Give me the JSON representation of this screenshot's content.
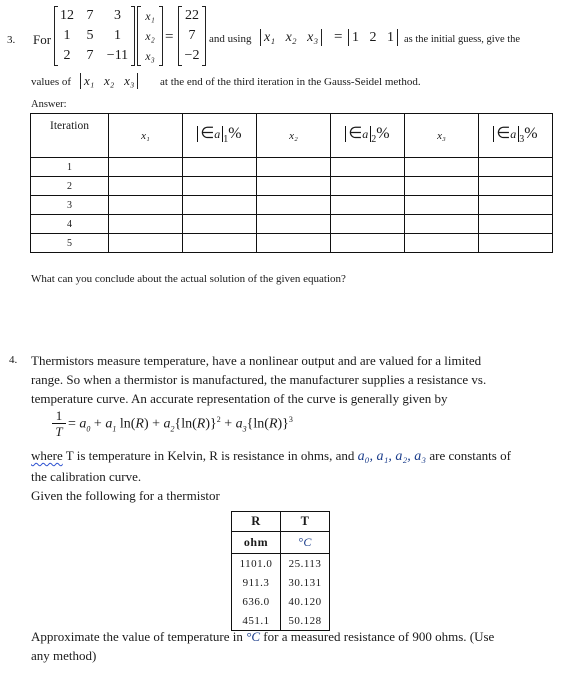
{
  "q3": {
    "number": "3.",
    "for_label": "For",
    "matrix_A": [
      [
        "12",
        "7",
        "3"
      ],
      [
        "1",
        "5",
        "1"
      ],
      [
        "2",
        "7",
        "−11"
      ]
    ],
    "vector_x": [
      "x₁",
      "x₂",
      "x₃"
    ],
    "equals": "=",
    "vector_b": [
      "22",
      "7",
      "−2"
    ],
    "and_using": "and using",
    "guess_vars": "x₁   x₂   x₃",
    "guess_vals": "1   2   1",
    "tail_line1": "as the initial guess, give the",
    "values_of": "values of",
    "values_vars": "x₁   x₂   x₃",
    "tail_line2": "at the end of the third iteration in the Gauss-Seidel method.",
    "answer_label": "Answer:",
    "table": {
      "headers": [
        "Iteration",
        "x₁",
        "|∈a|₁%",
        "x₂",
        "|∈a|₂%",
        "x₃",
        "|∈a|₃%"
      ],
      "header_x": [
        "x₁",
        "x₂",
        "x₃"
      ],
      "header_e_sub": [
        "1",
        "2",
        "3"
      ],
      "rows": [
        "1",
        "2",
        "3",
        "4",
        "5"
      ]
    },
    "conclusion_question": "What can you conclude about the actual solution of the given equation?"
  },
  "q4": {
    "number": "4.",
    "paragraph_line1": "Thermistors measure temperature, have a nonlinear output and are valued for a limited",
    "paragraph_line2": "range.  So when a thermistor is manufactured, the manufacturer supplies a resistance vs.",
    "paragraph_line3": "temperature curve.  An accurate representation of the curve is generally given by",
    "equation": "1/T = a₀ + a₁ ln(R) + a₂{ln(R)}² + a₃{ln(R)}³",
    "where_word": "where",
    "where_rest": " T is temperature in Kelvin, R is resistance in ohms, and",
    "constants": "a₀, a₁, a₂, a₃",
    "where_tail": "are constants of",
    "line_calibration": "the calibration curve.",
    "given_line": "Given the following for a thermistor",
    "table": {
      "col_headers": [
        "R",
        "T"
      ],
      "col_units": [
        "ohm",
        "°C"
      ],
      "rows": [
        [
          "1101.0",
          "25.113"
        ],
        [
          "911.3",
          "30.131"
        ],
        [
          "636.0",
          "40.120"
        ],
        [
          "451.1",
          "50.128"
        ]
      ]
    },
    "approx_line1_a": "Approximate the value of temperature in",
    "approx_unit": "°C",
    "approx_line1_b": "for a measured resistance of 900 ohms. (Use",
    "approx_line2": "any method)"
  }
}
